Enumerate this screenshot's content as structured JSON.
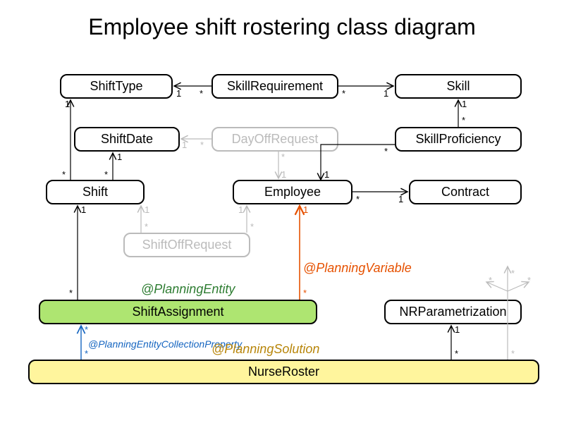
{
  "title": "Employee shift rostering class diagram",
  "classes": {
    "ShiftType": "ShiftType",
    "SkillRequirement": "SkillRequirement",
    "Skill": "Skill",
    "ShiftDate": "ShiftDate",
    "DayOffRequest": "DayOffRequest",
    "SkillProficiency": "SkillProficiency",
    "Shift": "Shift",
    "Employee": "Employee",
    "Contract": "Contract",
    "ShiftOffRequest": "ShiftOffRequest",
    "ShiftAssignment": "ShiftAssignment",
    "NRParametrization": "NRParametrization",
    "NurseRoster": "NurseRoster"
  },
  "annotations": {
    "planningEntity": "@PlanningEntity",
    "planningVariable": "@PlanningVariable",
    "planningEntityCollectionProperty": "@PlanningEntityCollectionProperty",
    "planningSolution": "@PlanningSolution"
  },
  "mult": {
    "one": "1",
    "many": "*"
  },
  "chart_data": {
    "type": "diagram",
    "title": "Employee shift rostering class diagram",
    "nodes": [
      {
        "id": "ShiftType",
        "stereotype": null
      },
      {
        "id": "SkillRequirement",
        "stereotype": null
      },
      {
        "id": "Skill",
        "stereotype": null
      },
      {
        "id": "ShiftDate",
        "stereotype": null
      },
      {
        "id": "DayOffRequest",
        "dimmed": true
      },
      {
        "id": "SkillProficiency",
        "stereotype": null
      },
      {
        "id": "Shift",
        "stereotype": null
      },
      {
        "id": "Employee",
        "stereotype": null
      },
      {
        "id": "Contract",
        "stereotype": null
      },
      {
        "id": "ShiftOffRequest",
        "dimmed": true
      },
      {
        "id": "ShiftAssignment",
        "stereotype": "@PlanningEntity"
      },
      {
        "id": "NRParametrization",
        "stereotype": null
      },
      {
        "id": "NurseRoster",
        "stereotype": "@PlanningSolution"
      }
    ],
    "edges": [
      {
        "from": "SkillRequirement",
        "to": "ShiftType",
        "fromMult": "*",
        "toMult": "1"
      },
      {
        "from": "SkillRequirement",
        "to": "Skill",
        "fromMult": "*",
        "toMult": "1"
      },
      {
        "from": "SkillProficiency",
        "to": "Skill",
        "fromMult": "*",
        "toMult": "1"
      },
      {
        "from": "SkillProficiency",
        "to": "Employee",
        "fromMult": "*",
        "toMult": "1"
      },
      {
        "from": "DayOffRequest",
        "to": "ShiftDate",
        "fromMult": "*",
        "toMult": "1",
        "dimmed": true
      },
      {
        "from": "DayOffRequest",
        "to": "Employee",
        "fromMult": "*",
        "toMult": "1",
        "dimmed": true
      },
      {
        "from": "Shift",
        "to": "ShiftDate",
        "fromMult": "*",
        "toMult": "1"
      },
      {
        "from": "Shift",
        "to": "ShiftType",
        "fromMult": "*",
        "toMult": "1"
      },
      {
        "from": "Employee",
        "to": "Contract",
        "fromMult": "*",
        "toMult": "1"
      },
      {
        "from": "ShiftOffRequest",
        "to": "Shift",
        "fromMult": "*",
        "toMult": "1",
        "dimmed": true
      },
      {
        "from": "ShiftOffRequest",
        "to": "Employee",
        "fromMult": "*",
        "toMult": "1",
        "dimmed": true
      },
      {
        "from": "ShiftAssignment",
        "to": "Shift",
        "fromMult": "*",
        "toMult": "1"
      },
      {
        "from": "ShiftAssignment",
        "to": "Employee",
        "fromMult": "*",
        "toMult": "1",
        "annotation": "@PlanningVariable"
      },
      {
        "from": "NurseRoster",
        "to": "ShiftAssignment",
        "fromMult": "*",
        "toMult": "*",
        "annotation": "@PlanningEntityCollectionProperty"
      },
      {
        "from": "NurseRoster",
        "to": "NRParametrization",
        "fromMult": "*",
        "toMult": "1"
      },
      {
        "from": "NurseRoster",
        "to": "others",
        "note": "fan-out to all other classes",
        "dimmed": true
      }
    ]
  }
}
